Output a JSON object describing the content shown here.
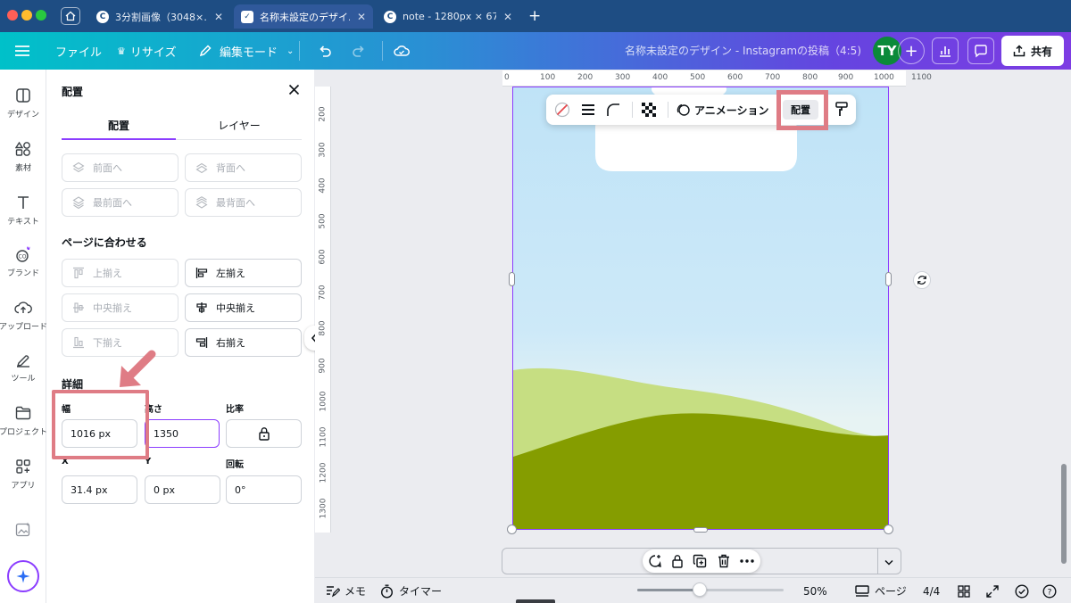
{
  "browser": {
    "tabs": [
      {
        "label": "3分割画像（3048×…",
        "active": false
      },
      {
        "label": "名称未設定のデザイ…",
        "active": true
      },
      {
        "label": "note - 1280px × 67…",
        "active": false
      }
    ],
    "new_tab_icon": "plus-icon"
  },
  "header": {
    "menu_file": "ファイル",
    "resize": "リサイズ",
    "edit_mode": "編集モード",
    "doc_title": "名称未設定のデザイン - Instagramの投稿（4:5)",
    "avatar_initials": "TY",
    "share": "共有"
  },
  "rail": {
    "items": [
      {
        "label": "デザイン",
        "icon": "design-icon"
      },
      {
        "label": "素材",
        "icon": "elements-icon"
      },
      {
        "label": "テキスト",
        "icon": "text-icon"
      },
      {
        "label": "ブランド",
        "icon": "brand-icon"
      },
      {
        "label": "アップロード",
        "icon": "upload-icon"
      },
      {
        "label": "ツール",
        "icon": "tools-icon"
      },
      {
        "label": "プロジェクト",
        "icon": "projects-icon"
      },
      {
        "label": "アプリ",
        "icon": "apps-icon"
      }
    ]
  },
  "panel": {
    "title": "配置",
    "tabs": [
      "配置",
      "レイヤー"
    ],
    "order_buttons": [
      "前面へ",
      "背面へ",
      "最前面へ",
      "最背面へ"
    ],
    "align_heading": "ページに合わせる",
    "align_buttons": [
      "上揃え",
      "左揃え",
      "中央揃え",
      "中央揃え",
      "下揃え",
      "右揃え"
    ],
    "details_heading": "詳細",
    "labels": {
      "width": "幅",
      "height": "高さ",
      "ratio": "比率",
      "x": "X",
      "y": "Y",
      "rotation": "回転"
    },
    "values": {
      "width": "1016 px",
      "height": "1350",
      "x": "31.4 px",
      "y": "0 px",
      "rotation": "0°"
    }
  },
  "canvas": {
    "hruler_ticks": [
      "0",
      "100",
      "200",
      "300",
      "400",
      "500",
      "600",
      "700",
      "800",
      "900",
      "1000",
      "1100"
    ],
    "vruler_ticks": [
      "200",
      "300",
      "400",
      "500",
      "600",
      "700",
      "800",
      "900",
      "1000",
      "1100",
      "1200",
      "1300"
    ],
    "context_toolbar": {
      "animation": "アニメーション",
      "arrange": "配置"
    }
  },
  "bottom": {
    "notes": "メモ",
    "timer": "タイマー",
    "zoom": "50%",
    "pages": "ページ",
    "page_count": "4/4"
  },
  "colors": {
    "accent": "#8b3dff",
    "highlight": "#df7c85",
    "hill_light": "#c6de82",
    "hill_dark": "#859d00"
  }
}
